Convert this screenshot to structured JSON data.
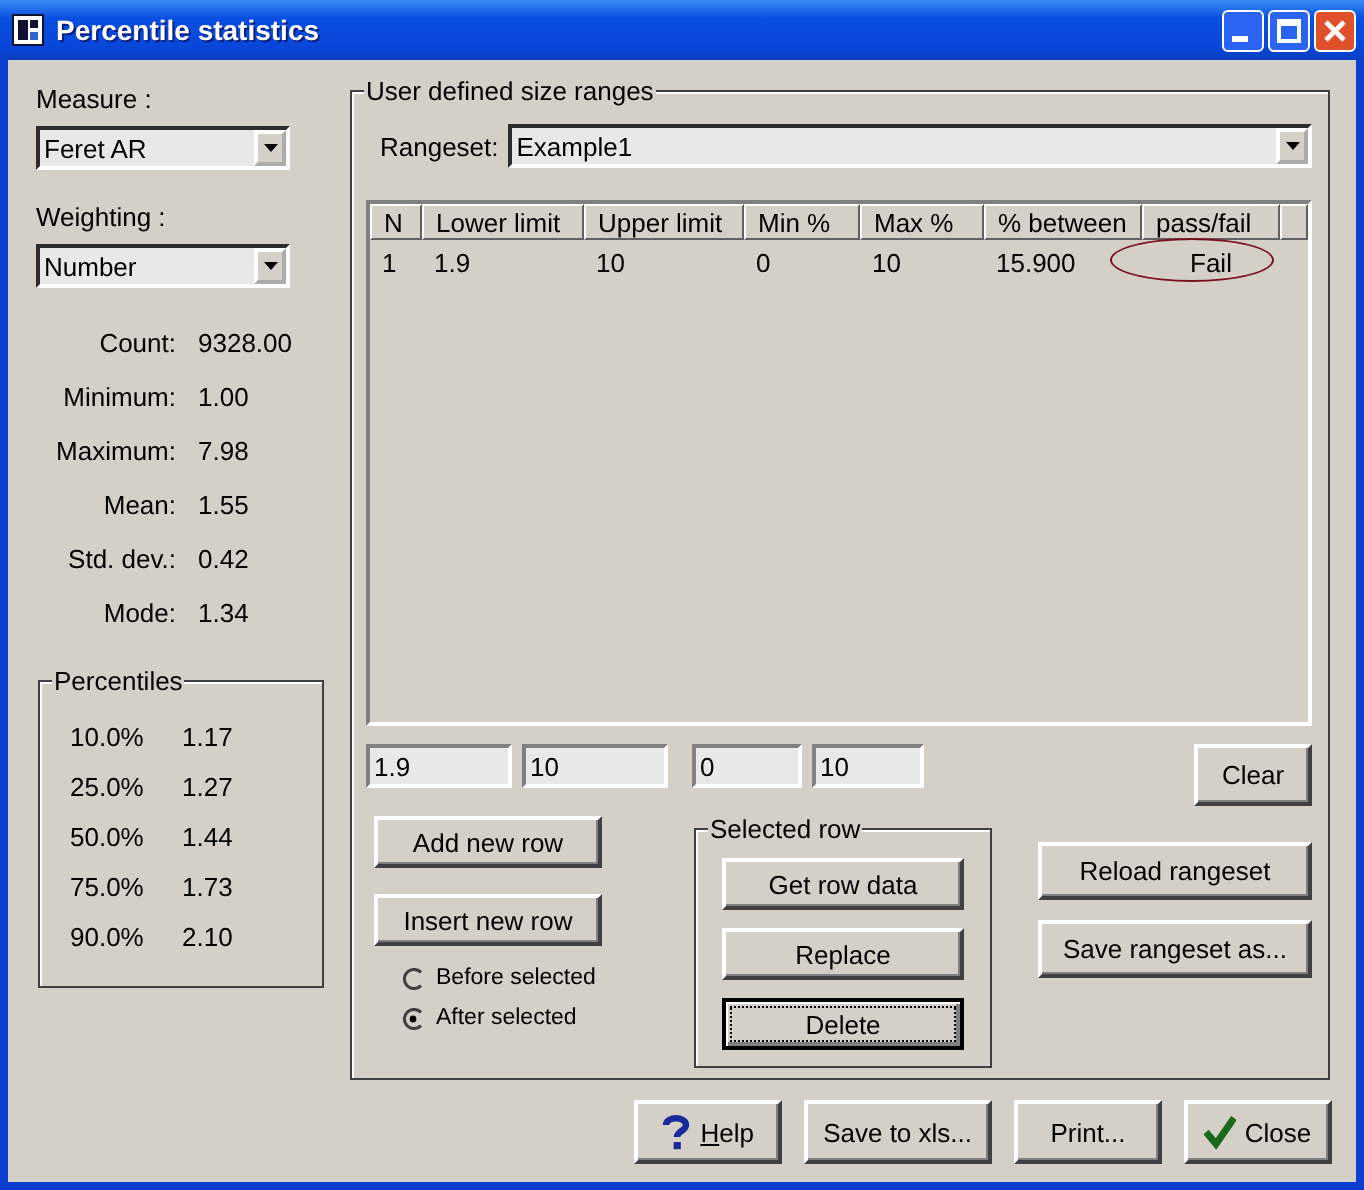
{
  "window": {
    "title": "Percentile statistics"
  },
  "measure": {
    "label": "Measure :",
    "value": "Feret AR"
  },
  "weighting": {
    "label": "Weighting :",
    "value": "Number"
  },
  "stats": [
    {
      "label": "Count:",
      "value": "9328.00"
    },
    {
      "label": "Minimum:",
      "value": "1.00"
    },
    {
      "label": "Maximum:",
      "value": "7.98"
    },
    {
      "label": "Mean:",
      "value": "1.55"
    },
    {
      "label": "Std. dev.:",
      "value": "0.42"
    },
    {
      "label": "Mode:",
      "value": "1.34"
    }
  ],
  "percentiles": {
    "title": "Percentiles",
    "rows": [
      {
        "percent": "10.0%",
        "value": "1.17"
      },
      {
        "percent": "25.0%",
        "value": "1.27"
      },
      {
        "percent": "50.0%",
        "value": "1.44"
      },
      {
        "percent": "75.0%",
        "value": "1.73"
      },
      {
        "percent": "90.0%",
        "value": "2.10"
      }
    ]
  },
  "ranges": {
    "title": "User defined size ranges",
    "rangeset": {
      "label": "Rangeset:",
      "value": "Example1"
    },
    "table": {
      "columns": [
        "N",
        "Lower limit",
        "Upper limit",
        "Min %",
        "Max %",
        "% between",
        "pass/fail"
      ],
      "rows": [
        {
          "cells": [
            "1",
            "1.9",
            "10",
            "0",
            "10",
            "15.900",
            "Fail"
          ],
          "circled": true
        }
      ]
    },
    "inputs": [
      "1.9",
      "10",
      "0",
      "10"
    ],
    "clear_button": "Clear",
    "row_buttons": [
      "Add new row",
      "Insert new row"
    ],
    "insert_position": [
      {
        "label": "Before selected",
        "selected": false
      },
      {
        "label": "After selected",
        "selected": true
      }
    ],
    "selected_row": {
      "title": "Selected row",
      "buttons": [
        {
          "label": "Get row data",
          "focused": false
        },
        {
          "label": "Replace",
          "focused": false
        },
        {
          "label": "Delete",
          "focused": true
        }
      ]
    },
    "rangeset_buttons": [
      "Reload rangeset",
      "Save rangeset as..."
    ]
  },
  "buttons": [
    {
      "label": "Help",
      "kind": "help"
    },
    {
      "label": "Save to xls...",
      "kind": "plain"
    },
    {
      "label": "Print...",
      "kind": "plain"
    },
    {
      "label": "Close",
      "kind": "close"
    }
  ]
}
